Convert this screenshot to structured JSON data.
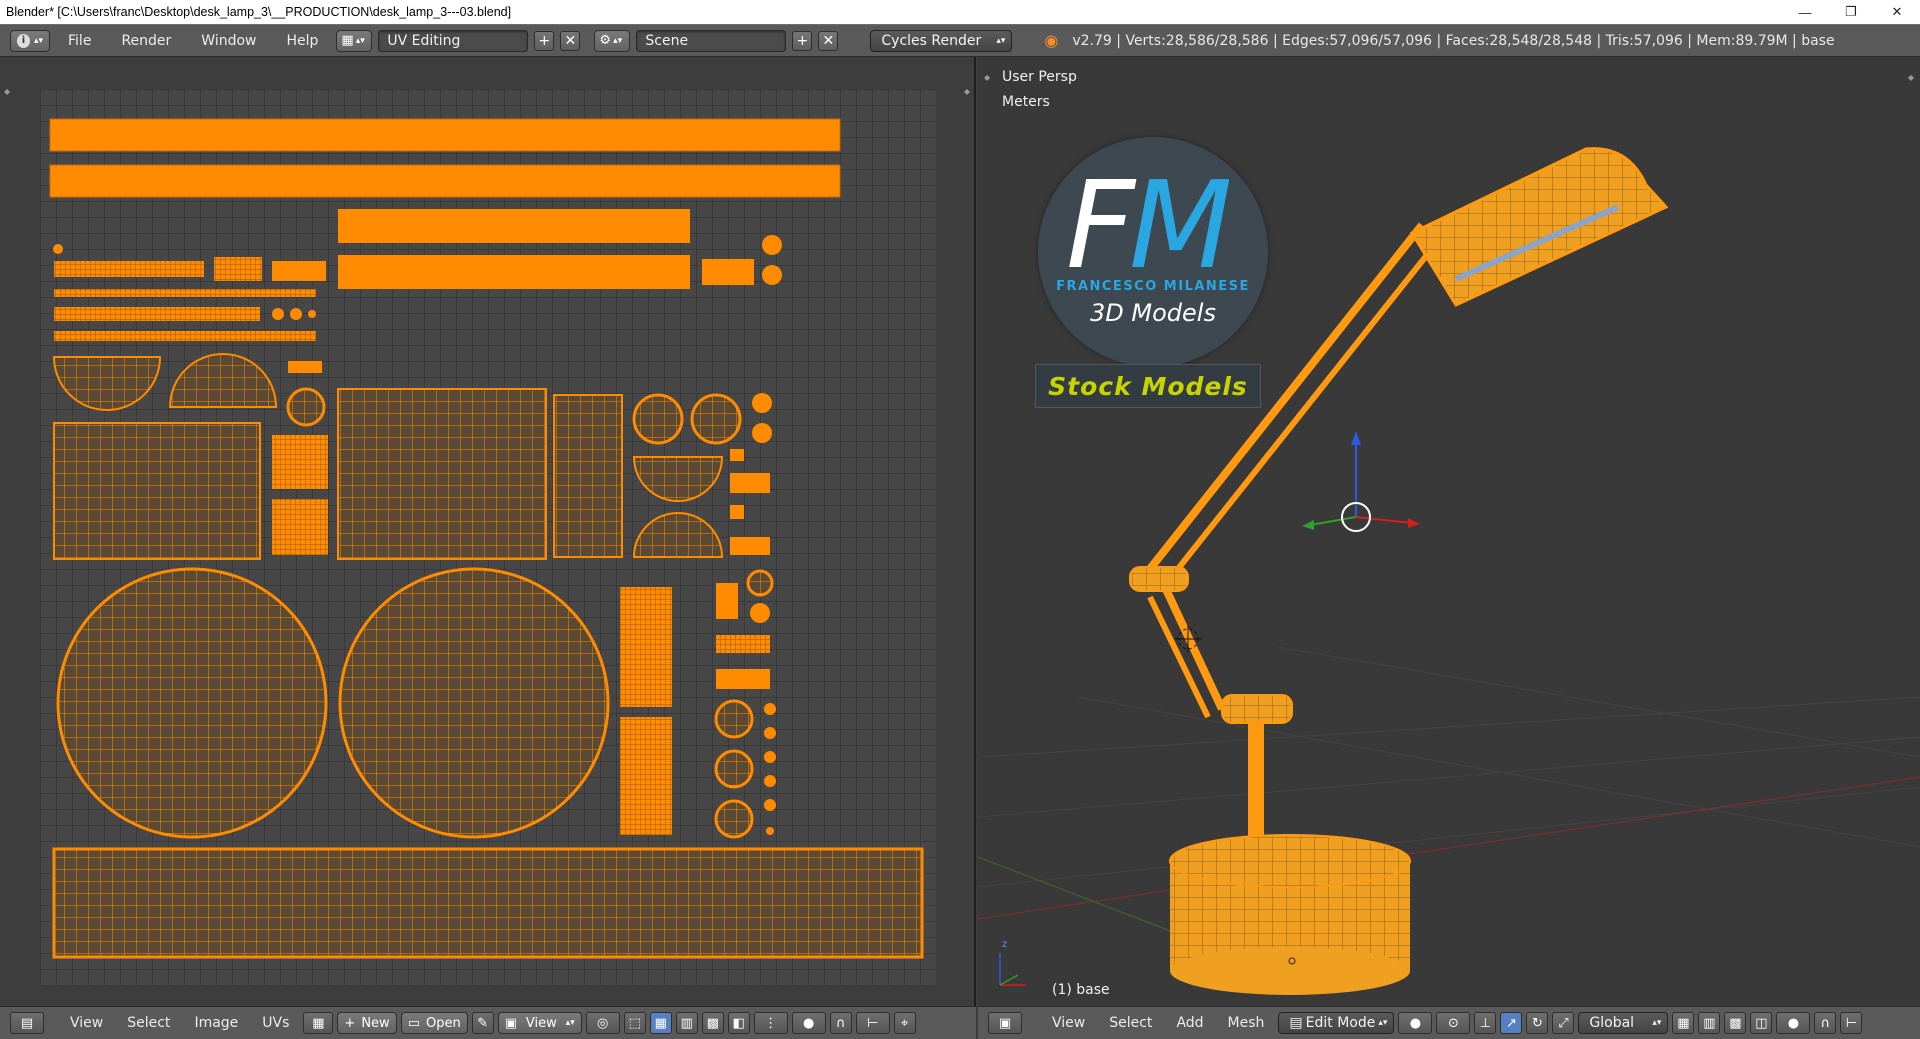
{
  "window": {
    "title": "Blender* [C:\\Users\\franc\\Desktop\\desk_lamp_3\\__PRODUCTION\\desk_lamp_3---03.blend]",
    "controls": [
      "—",
      "❐",
      "✕"
    ]
  },
  "infobar": {
    "menus": [
      "File",
      "Render",
      "Window",
      "Help"
    ],
    "layout": "UV Editing",
    "scene": "Scene",
    "engine": "Cycles Render",
    "stats": "v2.79 | Verts:28,586/28,586 | Edges:57,096/57,096 | Faces:28,548/28,548 | Tris:57,096 | Mem:89.79M | base"
  },
  "uv_editor": {
    "menus": [
      "View",
      "Select",
      "Image",
      "UVs"
    ],
    "new_label": "New",
    "open_label": "Open",
    "view_label": "View"
  },
  "viewport": {
    "projection": "User Persp",
    "units": "Meters",
    "object_label": "(1) base",
    "menus": [
      "View",
      "Select",
      "Add",
      "Mesh"
    ],
    "mode": "Edit Mode",
    "orientation": "Global"
  },
  "watermark": {
    "logo_f": "F",
    "logo_m": "M",
    "author": "FRANCESCO MILANESE",
    "tagline": "3D Models",
    "banner": "Stock Models"
  },
  "colors": {
    "mesh": "#ff8c00",
    "mesh_dark": "#7a4200",
    "header": "#5a5a5a",
    "background": "#3d3d3d",
    "logo_blue": "#2aa7e0",
    "banner_text": "#c8d400"
  }
}
